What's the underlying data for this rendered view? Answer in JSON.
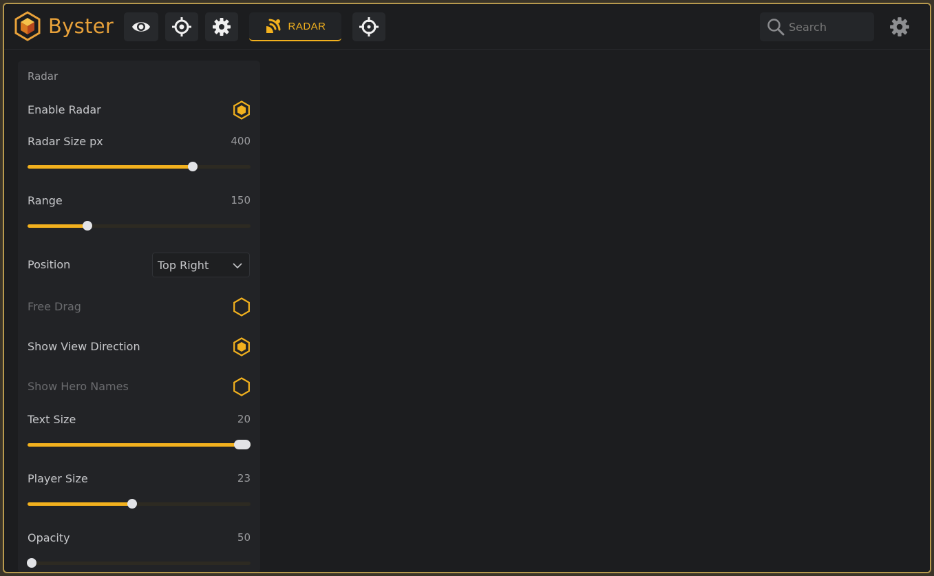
{
  "app": {
    "brand": "Byster",
    "accent": "#f2b11e"
  },
  "toolbar": {
    "tabs": [
      {
        "icon": "eye-icon"
      },
      {
        "icon": "target-icon"
      },
      {
        "icon": "gear-icon"
      },
      {
        "icon": "radar-icon",
        "label": "RADAR",
        "active": true
      },
      {
        "icon": "crosshair-icon"
      }
    ],
    "search_placeholder": "Search"
  },
  "panel": {
    "title": "Radar",
    "enable_radar": {
      "label": "Enable Radar",
      "on": true
    },
    "radar_size": {
      "label": "Radar Size px",
      "value": "400",
      "fraction": 0.74
    },
    "range": {
      "label": "Range",
      "value": "150",
      "fraction": 0.27
    },
    "position": {
      "label": "Position",
      "selected": "Top Right"
    },
    "free_drag": {
      "label": "Free Drag",
      "on": false
    },
    "show_view_direction": {
      "label": "Show View Direction",
      "on": true
    },
    "show_hero_names": {
      "label": "Show Hero Names",
      "on": false
    },
    "text_size": {
      "label": "Text Size",
      "value": "20",
      "fraction": 1.0
    },
    "player_size": {
      "label": "Player Size",
      "value": "23",
      "fraction": 0.47
    },
    "opacity": {
      "label": "Opacity",
      "value": "50",
      "fraction": 0.02
    }
  }
}
